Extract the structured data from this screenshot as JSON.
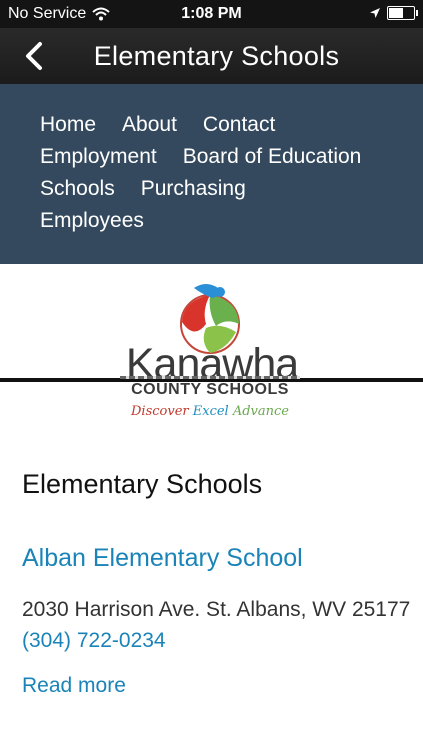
{
  "status_bar": {
    "carrier": "No Service",
    "time": "1:08 PM",
    "icons": [
      "wifi-icon",
      "location-arrow-icon",
      "battery-icon"
    ]
  },
  "nav_bar": {
    "title": "Elementary Schools",
    "back_icon": "chevron-left-icon"
  },
  "site_menu": {
    "items": [
      {
        "label": "Home"
      },
      {
        "label": "About"
      },
      {
        "label": "Contact"
      },
      {
        "label": "Employment"
      },
      {
        "label": "Board of Education"
      },
      {
        "label": "Schools"
      },
      {
        "label": "Purchasing"
      },
      {
        "label": "Employees"
      }
    ]
  },
  "logo": {
    "wordmark": "Kanawha",
    "subtitle": "COUNTY SCHOOLS",
    "tagline": [
      "Discover",
      "Excel",
      "Advance"
    ]
  },
  "content": {
    "heading": "Elementary Schools",
    "school": {
      "name": "Alban Elementary School",
      "address": "2030 Harrison Ave. St. Albans, WV 25177",
      "phone": "(304) 722-0234",
      "read_more": "Read more"
    }
  },
  "colors": {
    "status_bar_bg": "#141414",
    "nav_bar_bg": "#1f1f1f",
    "menu_bg": "#34495e",
    "link": "#1a84b8",
    "text": "#333333"
  }
}
